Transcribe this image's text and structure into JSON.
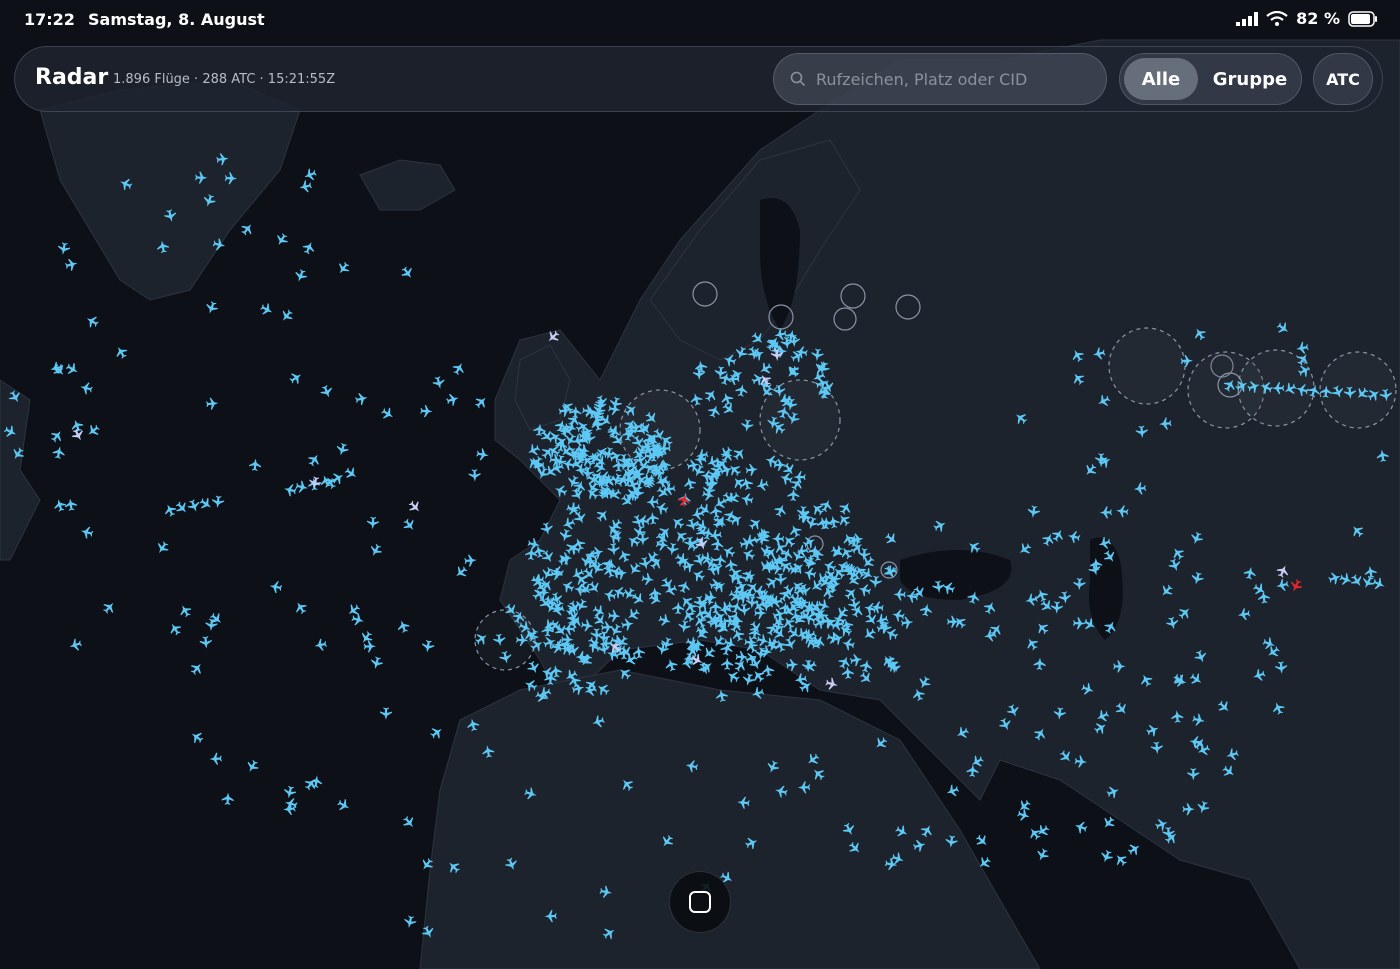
{
  "status_bar": {
    "time": "17:22",
    "date": "Samstag, 8. August",
    "battery_text": "82 %",
    "icons": [
      "signal-icon",
      "wifi-icon",
      "battery-icon"
    ]
  },
  "header": {
    "title": "Radar",
    "stats": "1.896 Flüge · 288 ATC · 15:21:55Z"
  },
  "search": {
    "placeholder": "Rufzeichen, Platz oder CID",
    "icon": "search-icon"
  },
  "filter": {
    "options": [
      "Alle",
      "Gruppe"
    ],
    "selected": "Alle"
  },
  "atc_button": {
    "label": "ATC"
  },
  "home_button": {
    "icon": "home-square-icon"
  },
  "colors": {
    "ocean": "#0d1017",
    "land": "#1d232d",
    "plane": "#5ec8f5",
    "selected_plane": "#c8cdf5",
    "alert_plane": "#e0262c",
    "atc_ring": "#8a94a6"
  }
}
